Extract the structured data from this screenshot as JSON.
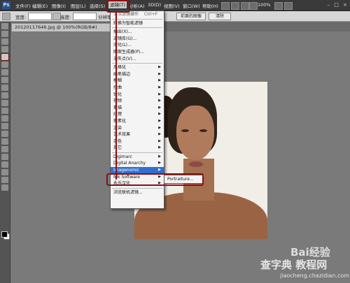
{
  "menubar": {
    "logo": "Ps",
    "items": [
      "文件(F)",
      "编辑(E)",
      "图像(I)",
      "图层(L)",
      "选择(S)",
      "滤镜(T)",
      "分析(A)",
      "3D(D)",
      "视图(V)",
      "窗口(W)",
      "帮助(H)"
    ],
    "zoom": "100%",
    "win_controls": [
      "–",
      "□",
      "×"
    ]
  },
  "optbar": {
    "width_label": "宽度:",
    "height_label": "高度:",
    "resolution_label": "分辨率:",
    "front_image_button": "前面的图像",
    "clear_button": "清除"
  },
  "document": {
    "tab_title": "20120117646.jpg @ 100%(RGB/8#)"
  },
  "filter_menu": {
    "last_filter": "上次滤镜操作",
    "last_filter_shortcut": "Ctrl+F",
    "group1": [
      "转换为智能滤镜"
    ],
    "group2": [
      "抽出(X)...",
      "滤镜库(G)...",
      "液化(L)...",
      "图案生成器(P)...",
      "消失点(V)..."
    ],
    "group3": [
      "风格化",
      "画笔描边",
      "模糊",
      "扭曲",
      "锐化",
      "视频",
      "素描",
      "纹理",
      "像素化",
      "渲染",
      "艺术效果",
      "杂色",
      "其它"
    ],
    "group4": [
      "Digimarc",
      "Digital Anarchy",
      "Imagenomic",
      "Nik Software",
      "永乐汉化"
    ],
    "group5": [
      "浏览联机滤镜..."
    ],
    "highlighted": "Imagenomic"
  },
  "submenu": {
    "item": "Portraiture..."
  },
  "watermark": {
    "baidu": "Bai经验",
    "site_cn": "查字典 教程网",
    "site_url": "jiaocheng.chazidian.com"
  },
  "colors": {
    "highlight_red": "#8b1010",
    "menu_highlight": "#2f6fcf",
    "workspace_gray": "#7a7a7a"
  }
}
